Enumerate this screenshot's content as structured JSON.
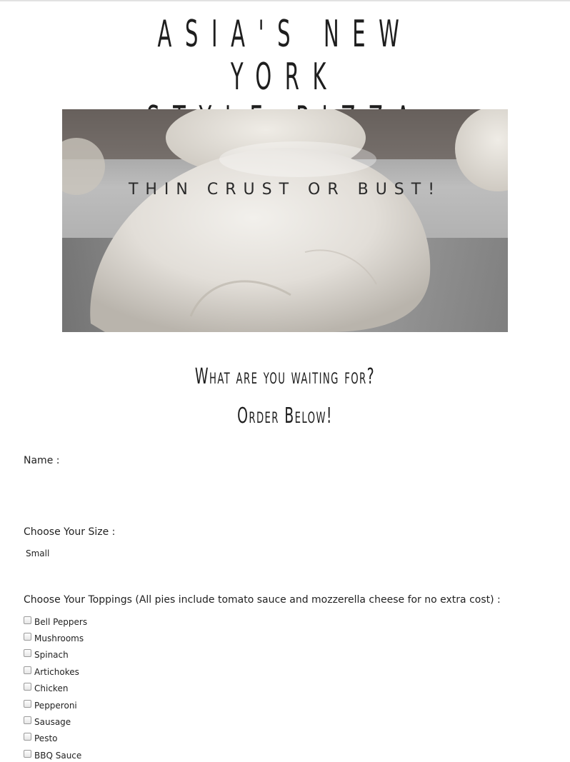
{
  "header": {
    "title_line1": "ASIA'S NEW YORK",
    "title_line2": "STYLE PIZZA"
  },
  "hero": {
    "tagline": "THIN CRUST OR BUST!"
  },
  "cta": {
    "line1": "What are you waiting for?",
    "line2": "Order Below!"
  },
  "form": {
    "name_label": "Name :",
    "size_label": "Choose Your Size :",
    "size_value": "Small",
    "toppings_label": "Choose Your Toppings (All pies include tomato sauce and mozzerella cheese for no extra cost) :",
    "toppings": [
      {
        "label": "Bell Peppers",
        "checked": false
      },
      {
        "label": "Mushrooms",
        "checked": false
      },
      {
        "label": "Spinach",
        "checked": false
      },
      {
        "label": "Artichokes",
        "checked": false
      },
      {
        "label": "Chicken",
        "checked": false
      },
      {
        "label": "Pepperoni",
        "checked": false
      },
      {
        "label": "Sausage",
        "checked": false
      },
      {
        "label": "Pesto",
        "checked": false
      },
      {
        "label": "BBQ Sauce",
        "checked": false
      }
    ]
  }
}
